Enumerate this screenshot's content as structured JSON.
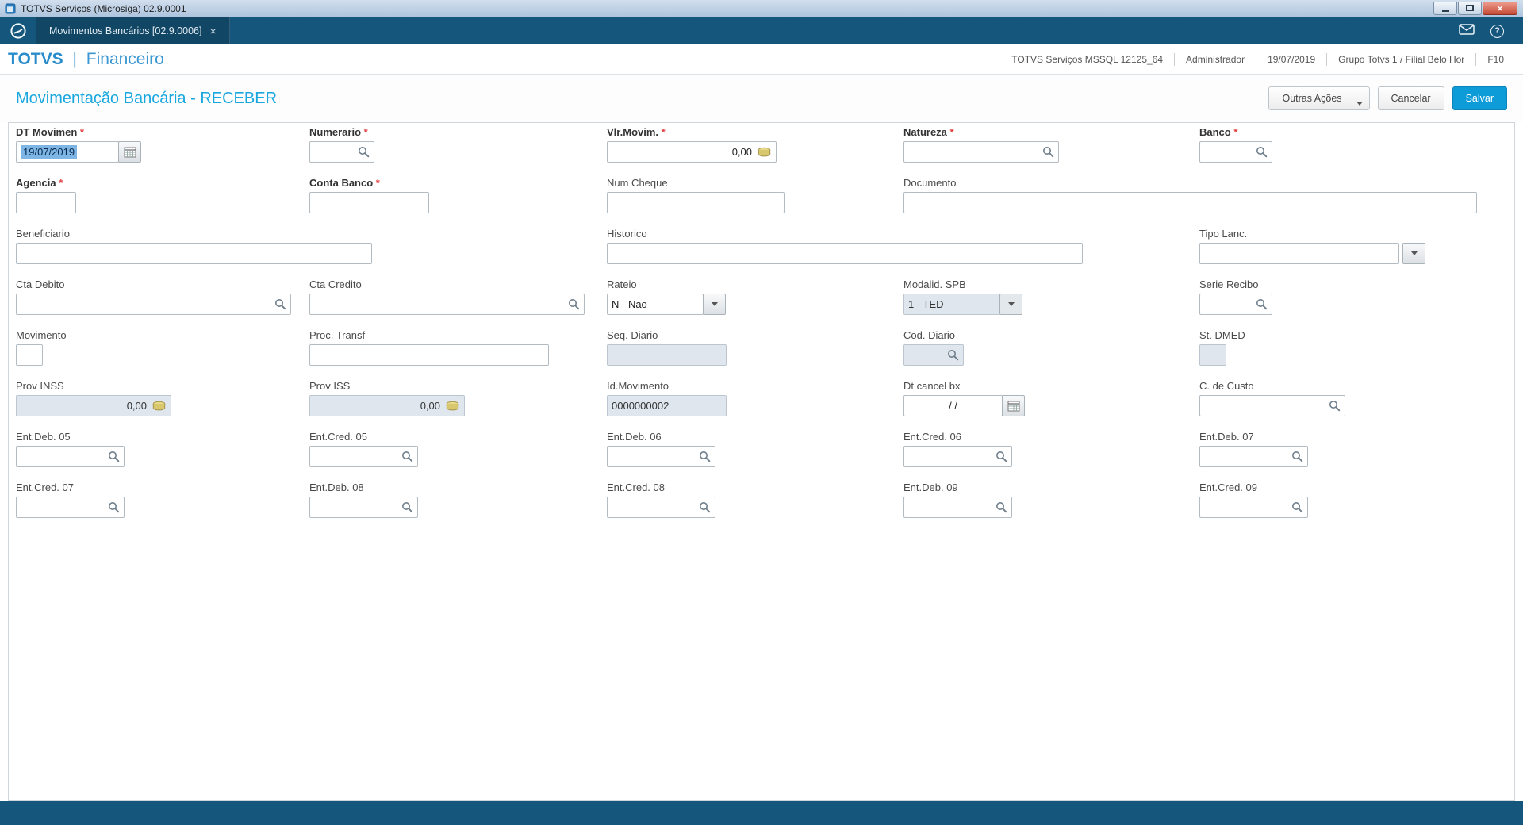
{
  "window": {
    "title": "TOTVS Serviços (Microsiga) 02.9.0001"
  },
  "tabbar": {
    "active_tab": {
      "label": "Movimentos Bancários [02.9.0006]",
      "close_label": "×"
    }
  },
  "header": {
    "brand_left": "TOTVS",
    "brand_sep": "|",
    "brand_right": "Financeiro",
    "info": [
      "TOTVS Serviços MSSQL 12125_64",
      "Administrador",
      "19/07/2019",
      "Grupo Totvs 1 / Filial Belo Hor",
      "F10"
    ]
  },
  "toolbar": {
    "page_title": "Movimentação Bancária - RECEBER",
    "buttons": {
      "outras_acoes": "Outras Ações",
      "cancelar": "Cancelar",
      "salvar": "Salvar"
    }
  },
  "form": {
    "fields": [
      {
        "id": "dt_movimen",
        "label": "DT Movimen",
        "required": true,
        "value": "19/07/2019",
        "selected": true,
        "side_button": "calendar"
      },
      {
        "id": "numerario",
        "label": "Numerario",
        "required": true,
        "value": "",
        "inner_icon": "search"
      },
      {
        "id": "vlr_movim",
        "label": "Vlr.Movim.",
        "required": true,
        "value": "0,00",
        "align": "right",
        "inner_icon": "money"
      },
      {
        "id": "natureza",
        "label": "Natureza",
        "required": true,
        "value": "",
        "inner_icon": "search"
      },
      {
        "id": "banco",
        "label": "Banco",
        "required": true,
        "value": "",
        "inner_icon": "search"
      },
      {
        "id": "agencia",
        "label": "Agencia",
        "required": true,
        "value": ""
      },
      {
        "id": "conta_banco",
        "label": "Conta Banco",
        "required": true,
        "value": ""
      },
      {
        "id": "num_cheque",
        "label": "Num Cheque",
        "value": ""
      },
      {
        "id": "documento",
        "label": "Documento",
        "value": ""
      },
      {
        "id": "beneficiario",
        "label": "Beneficiario",
        "value": ""
      },
      {
        "id": "historico",
        "label": "Historico",
        "value": ""
      },
      {
        "id": "tipo_lanc",
        "label": "Tipo Lanc.",
        "value": "",
        "side_button": "dropdown",
        "detached": true
      },
      {
        "id": "cta_debito",
        "label": "Cta Debito",
        "value": "",
        "inner_icon": "search"
      },
      {
        "id": "cta_credito",
        "label": "Cta Credito",
        "value": "",
        "inner_icon": "search"
      },
      {
        "id": "rateio",
        "label": "Rateio",
        "value": "N - Nao",
        "side_button": "dropdown"
      },
      {
        "id": "modalid_spb",
        "label": "Modalid. SPB",
        "value": "1 - TED",
        "side_button": "dropdown",
        "disabled": true
      },
      {
        "id": "serie_recibo",
        "label": "Serie Recibo",
        "value": "",
        "inner_icon": "search"
      },
      {
        "id": "movimento",
        "label": "Movimento",
        "value": ""
      },
      {
        "id": "proc_transf",
        "label": "Proc. Transf",
        "value": ""
      },
      {
        "id": "seq_diario",
        "label": "Seq. Diario",
        "value": "",
        "disabled": true
      },
      {
        "id": "cod_diario",
        "label": "Cod. Diario",
        "value": "",
        "inner_icon": "search",
        "disabled": true
      },
      {
        "id": "st_dmed",
        "label": "St. DMED",
        "value": "",
        "disabled": true
      },
      {
        "id": "prov_inss",
        "label": "Prov INSS",
        "value": "0,00",
        "align": "right",
        "inner_icon": "money",
        "disabled": true
      },
      {
        "id": "prov_iss",
        "label": "Prov ISS",
        "value": "0,00",
        "align": "right",
        "inner_icon": "money",
        "disabled": true
      },
      {
        "id": "id_movimento",
        "label": "Id.Movimento",
        "value": "0000000002",
        "disabled": true
      },
      {
        "id": "dt_cancel_bx",
        "label": "Dt cancel bx",
        "value": "/ /",
        "align": "center",
        "side_button": "calendar"
      },
      {
        "id": "c_de_custo",
        "label": "C. de Custo",
        "value": "",
        "inner_icon": "search"
      },
      {
        "id": "ent_deb_05",
        "label": "Ent.Deb. 05",
        "value": "",
        "inner_icon": "search"
      },
      {
        "id": "ent_cred_05",
        "label": "Ent.Cred. 05",
        "value": "",
        "inner_icon": "search"
      },
      {
        "id": "ent_deb_06",
        "label": "Ent.Deb. 06",
        "value": "",
        "inner_icon": "search"
      },
      {
        "id": "ent_cred_06",
        "label": "Ent.Cred. 06",
        "value": "",
        "inner_icon": "search"
      },
      {
        "id": "ent_deb_07",
        "label": "Ent.Deb. 07",
        "value": "",
        "inner_icon": "search"
      },
      {
        "id": "ent_cred_07",
        "label": "Ent.Cred. 07",
        "value": "",
        "inner_icon": "search"
      },
      {
        "id": "ent_deb_08",
        "label": "Ent.Deb. 08",
        "value": "",
        "inner_icon": "search"
      },
      {
        "id": "ent_cred_08",
        "label": "Ent.Cred. 08",
        "value": "",
        "inner_icon": "search"
      },
      {
        "id": "ent_deb_09",
        "label": "Ent.Deb. 09",
        "value": "",
        "inner_icon": "search"
      },
      {
        "id": "ent_cred_09",
        "label": "Ent.Cred. 09",
        "value": "",
        "inner_icon": "search"
      }
    ]
  }
}
